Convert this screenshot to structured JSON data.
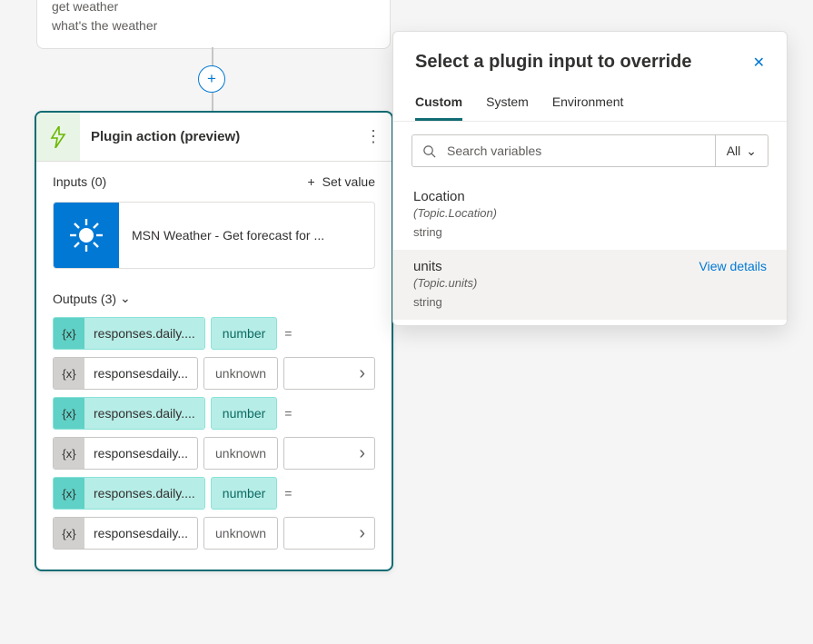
{
  "trigger": {
    "line1": "get weather",
    "line2": "what's the weather"
  },
  "card": {
    "title": "Plugin action (preview)",
    "inputs_label": "Inputs (0)",
    "set_value_label": "Set value",
    "tile_label": "MSN Weather - Get forecast for ...",
    "outputs_label": "Outputs (3)",
    "outputs": [
      {
        "style": "teal",
        "name": "responses.daily....",
        "type": "number",
        "trailing": "eq"
      },
      {
        "style": "gray",
        "name": "responsesdaily...",
        "type": "unknown",
        "trailing": "arrow"
      },
      {
        "style": "teal",
        "name": "responses.daily....",
        "type": "number",
        "trailing": "eq"
      },
      {
        "style": "gray",
        "name": "responsesdaily...",
        "type": "unknown",
        "trailing": "arrow"
      },
      {
        "style": "teal",
        "name": "responses.daily....",
        "type": "number",
        "trailing": "eq"
      },
      {
        "style": "gray",
        "name": "responsesdaily...",
        "type": "unknown",
        "trailing": "arrow"
      }
    ]
  },
  "panel": {
    "title": "Select a plugin input to override",
    "tabs": {
      "custom": "Custom",
      "system": "System",
      "environment": "Environment"
    },
    "search_placeholder": "Search variables",
    "filter_label": "All",
    "vars": [
      {
        "name": "Location",
        "path": "(Topic.Location)",
        "type": "string",
        "selected": false,
        "details": ""
      },
      {
        "name": "units",
        "path": "(Topic.units)",
        "type": "string",
        "selected": true,
        "details": "View details"
      }
    ]
  },
  "glyphs": {
    "badge": "{x}",
    "eq": "=",
    "chevron_right": "›",
    "chevron_down": "⌄",
    "plus": "+",
    "close": "✕",
    "more": "⋮"
  }
}
